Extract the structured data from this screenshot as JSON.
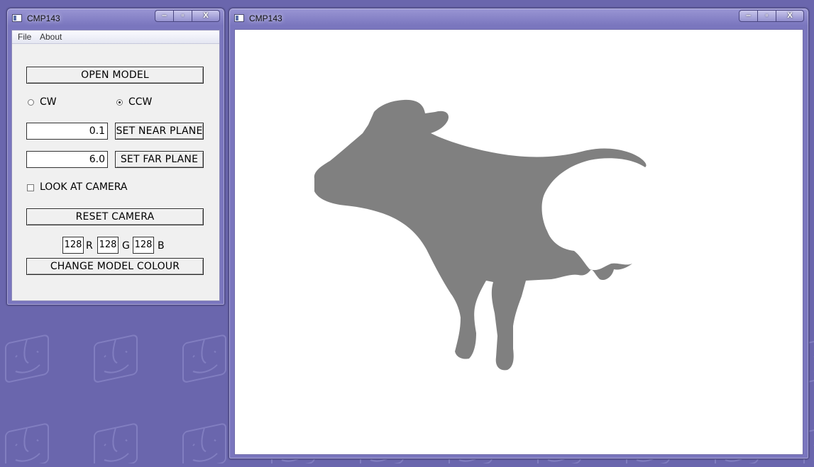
{
  "control_window": {
    "title": "CMP143",
    "caption_buttons": {
      "minimize": "‒",
      "maximize": "▫",
      "close": "X"
    },
    "menu": [
      "File",
      "About"
    ],
    "open_model_label": "OPEN MODEL",
    "winding": {
      "options": [
        "CW",
        "CCW"
      ],
      "selected": "CCW"
    },
    "near_plane": {
      "value": "0.1",
      "button": "SET NEAR PLANE"
    },
    "far_plane": {
      "value": "6.0",
      "button": "SET FAR PLANE"
    },
    "look_at_camera": {
      "label": "LOOK AT CAMERA",
      "checked": false
    },
    "reset_camera_label": "RESET CAMERA",
    "colour": {
      "r": "128",
      "g": "128",
      "b": "128",
      "r_label": "R",
      "g_label": "G",
      "b_label": "B"
    },
    "change_colour_label": "CHANGE MODEL COLOUR"
  },
  "viewport_window": {
    "title": "CMP143",
    "background": "#ffffff",
    "model_colour": "#808080"
  },
  "desktop": {
    "background": "#6a66ad",
    "wallpaper_icon": "finder-face-icon"
  }
}
